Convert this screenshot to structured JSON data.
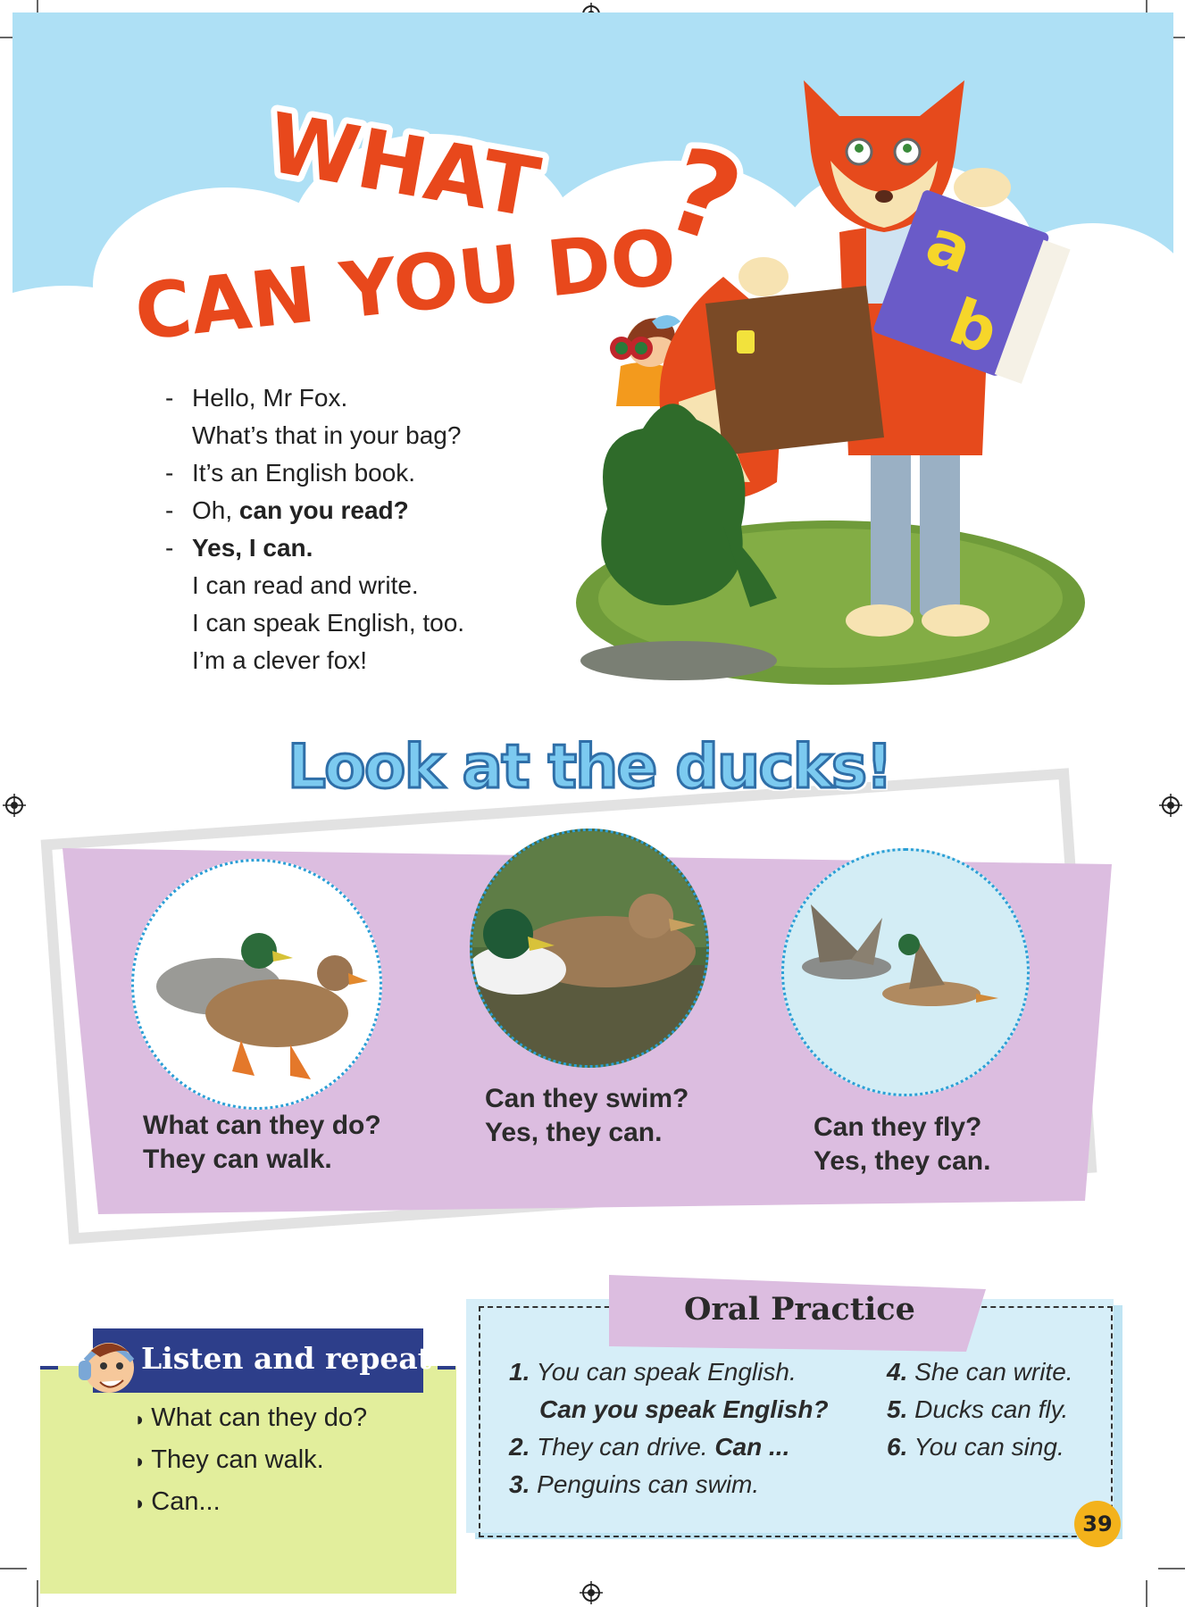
{
  "title": {
    "line1": "WHAT",
    "line2": "CAN YOU DO",
    "mark": "?"
  },
  "dialog": [
    {
      "dash": "-",
      "text": "Hello, Mr Fox.",
      "bold": ""
    },
    {
      "dash": "",
      "text": "What’s that in your bag?",
      "bold": ""
    },
    {
      "dash": "-",
      "text": "It’s an English book.",
      "bold": ""
    },
    {
      "dash": "-",
      "text": "Oh, ",
      "bold": "can you read?"
    },
    {
      "dash": "-",
      "text": "",
      "bold": "Yes, I can."
    },
    {
      "dash": "",
      "text": "I can read and write.",
      "bold": ""
    },
    {
      "dash": "",
      "text": "I can speak English, too.",
      "bold": ""
    },
    {
      "dash": "",
      "text": "I’m a clever fox!",
      "bold": ""
    }
  ],
  "book_letters": {
    "top": "a",
    "bottom": "b"
  },
  "ducks": {
    "heading": "Look at the ducks!",
    "walk": {
      "q": "What can they do?",
      "a": "They can walk."
    },
    "swim": {
      "q": "Can they swim?",
      "a": "Yes, they can."
    },
    "fly": {
      "q": "Can they fly?",
      "a": "Yes, they can."
    }
  },
  "listen": {
    "title": "Listen and repeat",
    "items": [
      "What can they do?",
      "They can walk.",
      "Can..."
    ],
    "bullet": "◗"
  },
  "oral": {
    "title": "Oral Practice",
    "items": [
      {
        "n": "1.",
        "text": "You can speak English.",
        "sub": "Can you speak English?"
      },
      {
        "n": "2.",
        "text": "They can drive. ",
        "bold": "Can ..."
      },
      {
        "n": "3.",
        "text": "Penguins can swim."
      },
      {
        "n": "4.",
        "text": "She can write."
      },
      {
        "n": "5.",
        "text": "Ducks can fly."
      },
      {
        "n": "6.",
        "text": "You can sing."
      }
    ]
  },
  "page_number": "39",
  "colors": {
    "sky": "#aee0f5",
    "title_orange": "#e8481c",
    "lilac": "#dcbde0",
    "lime": "#e2ee9c",
    "navy": "#2d3e8a",
    "pale_blue": "#d6eef8",
    "page_badge": "#f3b21b"
  }
}
